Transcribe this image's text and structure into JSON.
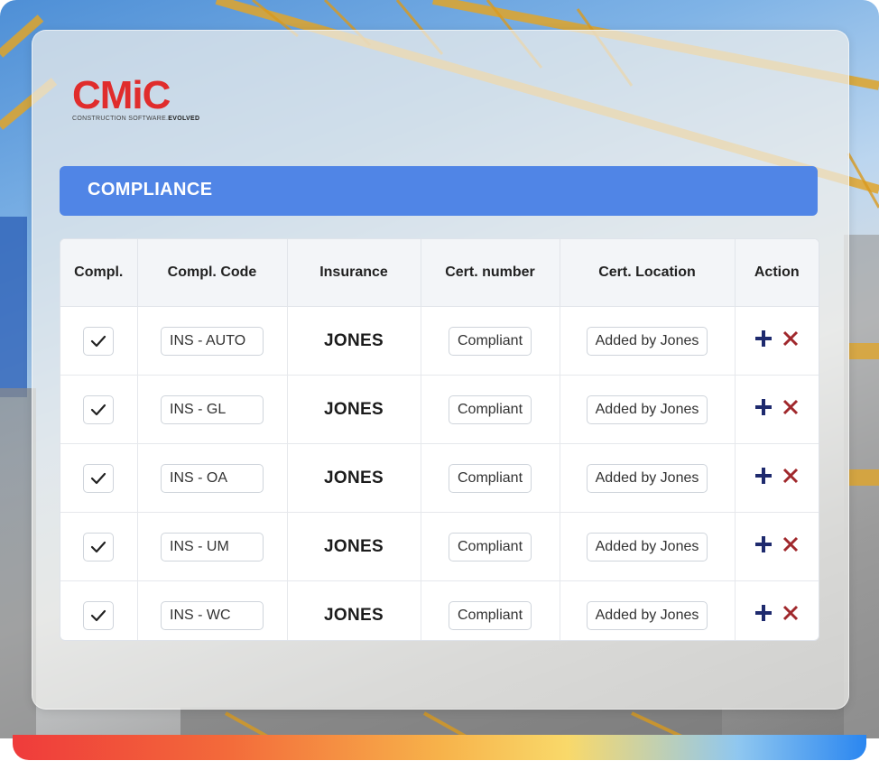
{
  "brand": {
    "logo_word": "CMiC",
    "tagline_prefix": "CONSTRUCTION SOFTWARE.",
    "tagline_suffix": "EVOLVED",
    "accent_red": "#e02c2c"
  },
  "header": {
    "title": "COMPLIANCE",
    "color": "#5085e6"
  },
  "table": {
    "columns": [
      "Compl.",
      "Compl. Code",
      "Insurance",
      "Cert. number",
      "Cert. Location",
      "Action"
    ],
    "rows": [
      {
        "checked": true,
        "code": "INS - AUTO",
        "insurance": "JONES",
        "cert_number": "Compliant",
        "cert_location": "Added by Jones"
      },
      {
        "checked": true,
        "code": "INS - GL",
        "insurance": "JONES",
        "cert_number": "Compliant",
        "cert_location": "Added by Jones"
      },
      {
        "checked": true,
        "code": "INS - OA",
        "insurance": "JONES",
        "cert_number": "Compliant",
        "cert_location": "Added by Jones"
      },
      {
        "checked": true,
        "code": "INS - UM",
        "insurance": "JONES",
        "cert_number": "Compliant",
        "cert_location": "Added by Jones"
      },
      {
        "checked": true,
        "code": "INS - WC",
        "insurance": "JONES",
        "cert_number": "Compliant",
        "cert_location": "Added by Jones"
      }
    ],
    "icons": {
      "check": "check-icon",
      "add": "plus-icon",
      "remove": "close-icon"
    },
    "colors": {
      "add": "#1e2a6e",
      "remove": "#a0282c"
    }
  }
}
